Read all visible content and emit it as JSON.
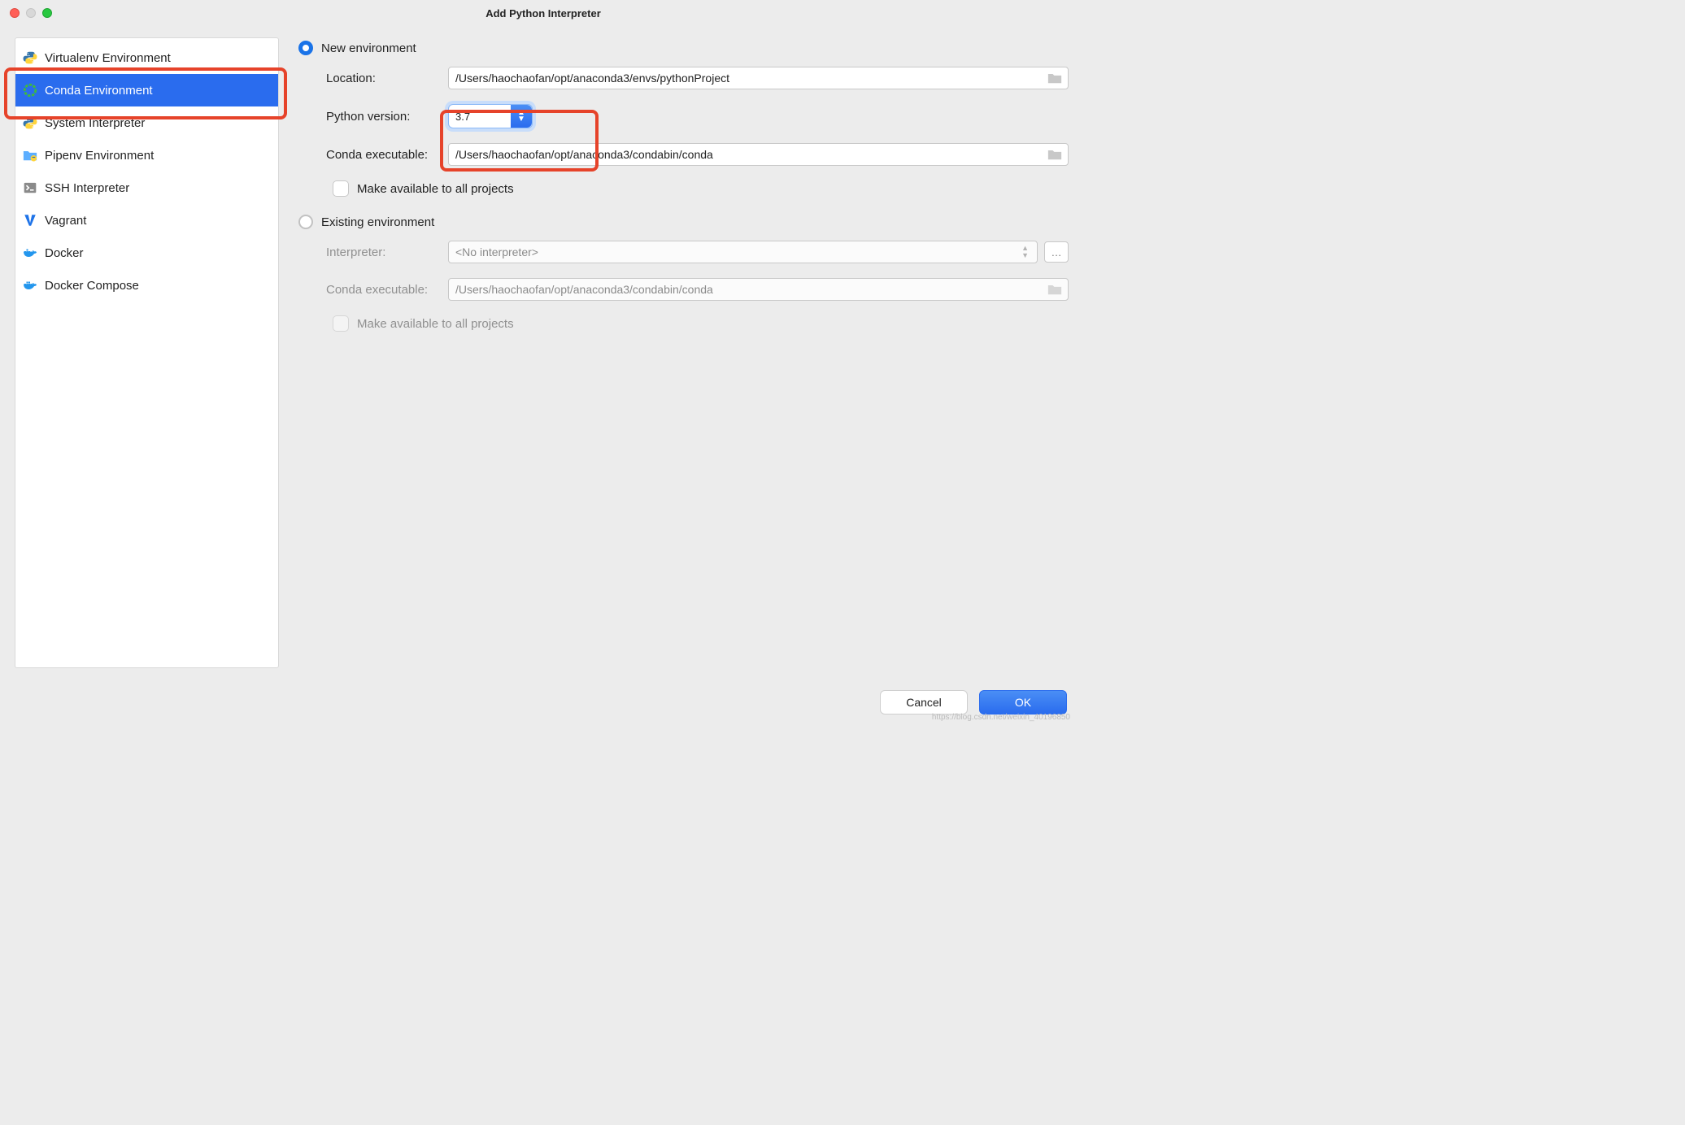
{
  "window": {
    "title": "Add Python Interpreter"
  },
  "sidebar": {
    "items": [
      {
        "label": "Virtualenv Environment"
      },
      {
        "label": "Conda Environment"
      },
      {
        "label": "System Interpreter"
      },
      {
        "label": "Pipenv Environment"
      },
      {
        "label": "SSH Interpreter"
      },
      {
        "label": "Vagrant"
      },
      {
        "label": "Docker"
      },
      {
        "label": "Docker Compose"
      }
    ],
    "selected_index": 1
  },
  "form": {
    "new_env": {
      "radio_label": "New environment",
      "location_label": "Location:",
      "location_value": "/Users/haochaofan/opt/anaconda3/envs/pythonProject",
      "version_label": "Python version:",
      "version_value": "3.7",
      "conda_exec_label": "Conda executable:",
      "conda_exec_value": "/Users/haochaofan/opt/anaconda3/condabin/conda",
      "make_available_label": "Make available to all projects"
    },
    "existing_env": {
      "radio_label": "Existing environment",
      "interpreter_label": "Interpreter:",
      "interpreter_value": "<No interpreter>",
      "conda_exec_label": "Conda executable:",
      "conda_exec_value": "/Users/haochaofan/opt/anaconda3/condabin/conda",
      "make_available_label": "Make available to all projects"
    }
  },
  "footer": {
    "cancel": "Cancel",
    "ok": "OK"
  },
  "watermark": "https://blog.csdn.net/weixin_40196850"
}
